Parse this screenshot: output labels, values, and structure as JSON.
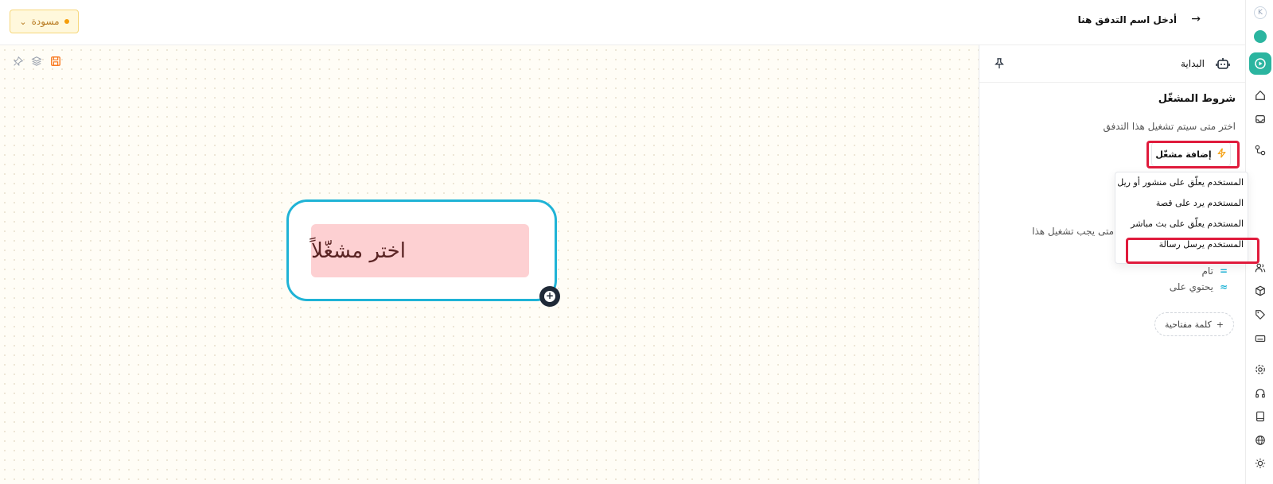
{
  "header": {
    "draft_label": "مسودة",
    "flow_name_placeholder": "أدخل اسم التدفق هنا"
  },
  "canvas": {
    "node_label": "اختر مشغّلاً"
  },
  "panel": {
    "start_label": "البداية",
    "section_title": "شروط المشغّل",
    "section_subtitle": "اختر متى سيتم تشغيل هذا التدفق",
    "add_trigger_label": "إضافة مشغّل",
    "background_text": "متى يجب تشغيل هذا",
    "conditions": [
      {
        "symbol": "=",
        "label": "تام"
      },
      {
        "symbol": "≈",
        "label": "يحتوي على"
      }
    ],
    "keyword_button_label": "كلمة مفتاحية"
  },
  "dropdown": {
    "items": [
      "المستخدم يعلّق على منشور أو ريل",
      "المستخدم يرد على قصة",
      "المستخدم يعلّق على بث مباشر",
      "المستخدم يرسل رسالة"
    ]
  },
  "sidebar": {
    "avatar_letter": "K"
  },
  "colors": {
    "accent": "#1fb3d6",
    "teal": "#2bb5a0",
    "highlight": "#e01b3c",
    "node_fill": "#fdd0d2",
    "draft_bg": "#fff8dc"
  }
}
